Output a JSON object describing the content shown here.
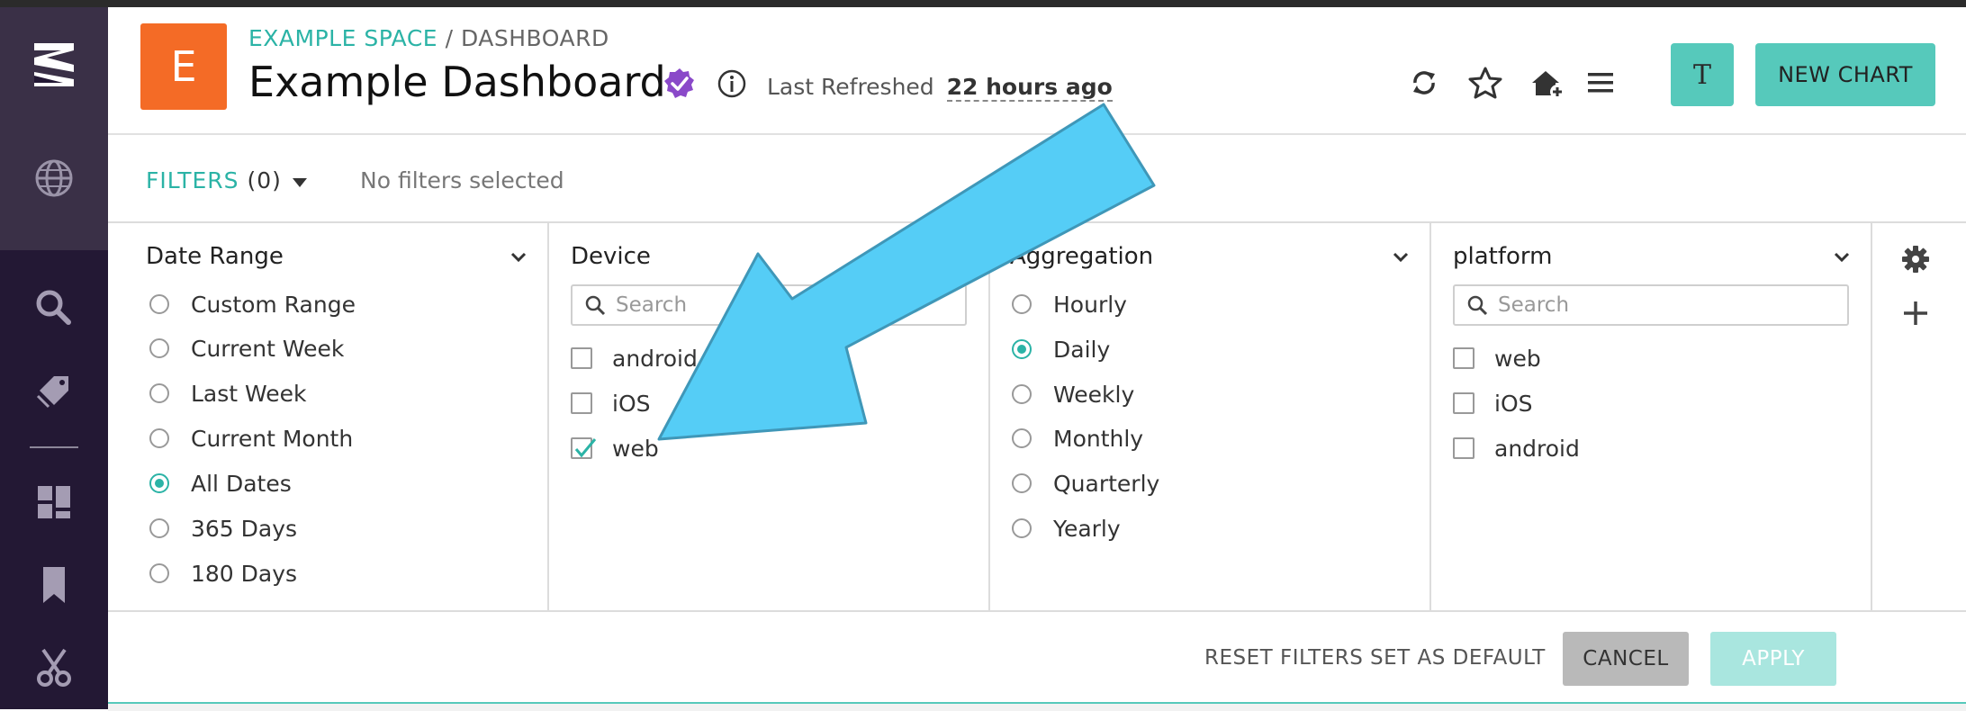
{
  "header": {
    "space_badge_letter": "E",
    "breadcrumb_space": "EXAMPLE SPACE",
    "breadcrumb_separator": "/",
    "breadcrumb_page": "DASHBOARD",
    "title": "Example Dashboard",
    "last_refreshed_label": "Last Refreshed",
    "last_refreshed_value": "22 hours ago",
    "user_initial": "T",
    "new_chart_label": "NEW CHART"
  },
  "filterbar": {
    "filters_label": "FILTERS",
    "filters_count": "(0)",
    "status_text": "No filters selected"
  },
  "panels": {
    "date_range": {
      "title": "Date Range",
      "options": [
        "Custom Range",
        "Current Week",
        "Last Week",
        "Current Month",
        "All Dates",
        "365 Days",
        "180 Days"
      ],
      "selected": "All Dates"
    },
    "device": {
      "title": "Device",
      "search_placeholder": "Search",
      "options": [
        "android",
        "iOS",
        "web"
      ],
      "checked": [
        "web"
      ]
    },
    "aggregation": {
      "title": "Aggregation",
      "options": [
        "Hourly",
        "Daily",
        "Weekly",
        "Monthly",
        "Quarterly",
        "Yearly"
      ],
      "selected": "Daily"
    },
    "platform": {
      "title": "platform",
      "search_placeholder": "Search",
      "options": [
        "web",
        "iOS",
        "android"
      ],
      "checked": []
    }
  },
  "footer": {
    "reset_label": "RESET FILTERS",
    "set_default_label": "SET AS DEFAULT",
    "cancel_label": "CANCEL",
    "apply_label": "APPLY"
  },
  "colors": {
    "accent": "#2bb3a6",
    "brand_orange": "#f46b26",
    "nav_bg": "#231834",
    "annotation_arrow": "#55cdf6"
  },
  "icons": [
    "logo-icon",
    "globe-icon",
    "search-icon",
    "tag-icon",
    "dashboard-icon",
    "bookmark-icon",
    "scissors-icon",
    "verified-badge-icon",
    "info-icon",
    "refresh-icon",
    "star-icon",
    "home-add-icon",
    "menu-icon",
    "chevron-down-icon",
    "gear-icon",
    "plus-icon",
    "annotation-arrow"
  ]
}
